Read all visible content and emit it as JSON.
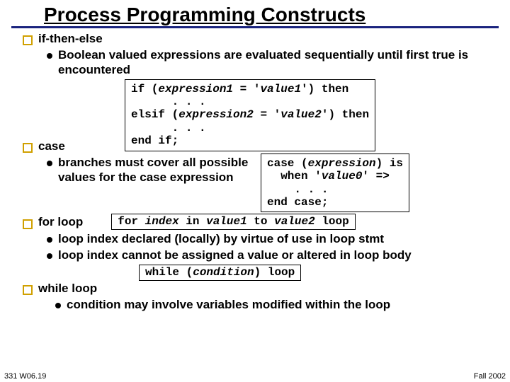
{
  "title": "Process Programming Constructs",
  "s1": {
    "heading": "if-then-else",
    "bullet": "Boolean valued expressions are evaluated sequentially until first true is encountered",
    "code": "if (expression1 = 'value1') then\n      . . .\nelsif (expression2 = 'value2') then\n      . . .\nend if;",
    "code_html": "if (<span class='kw'>expression1</span> = '<span class='kw'>value1</span>') then\n      . . .\nelsif (<span class='kw'>expression2</span> = '<span class='kw'>value2</span>') then\n      . . .\nend if;"
  },
  "s2": {
    "heading": "case",
    "bullet": "branches must cover all possible values for the case expression",
    "code": "case (expression) is\n  when 'value0' =>\n    . . .\nend case;",
    "code_html": "case (<span class='kw'>expression</span>) is\n  when '<span class='kw'>value0</span>' =>\n    . . .\nend case;"
  },
  "s3": {
    "heading": "for loop",
    "code": "for index in value1 to value2 loop",
    "code_html": "for <span class='kw'>index</span> in <span class='kw'>value1</span> to <span class='kw'>value2</span> loop",
    "b1": "loop index declared (locally) by virtue of use in loop stmt",
    "b2": "loop index cannot be assigned a value or altered in loop body"
  },
  "s4": {
    "heading": "while loop",
    "code": "while (condition) loop",
    "code_html": "while (<span class='kw'>condition</span>) loop",
    "bullet": "condition may involve variables modified within the loop"
  },
  "footer_left": "331 W06.19",
  "footer_right": "Fall 2002"
}
